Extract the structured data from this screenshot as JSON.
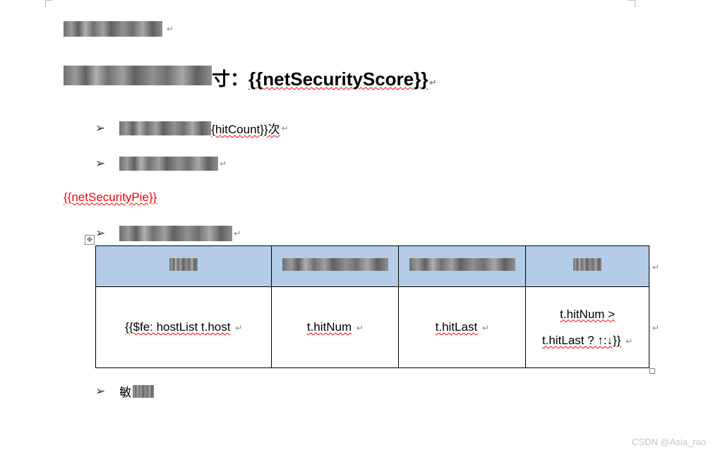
{
  "heading": {
    "suffix_char": "寸：",
    "placeholder": "{{netSecurityScore}}"
  },
  "bullets": {
    "b1_suffix": "{hitCount}}次",
    "b3_prefix": "敏"
  },
  "red_placeholder": "{{netSecurityPie}}",
  "table": {
    "rows": [
      {
        "c1": "{{$fe: hostList t.host",
        "c2": "t.hitNum",
        "c3": "t.hitLast",
        "c4_line1": "t.hitNum >",
        "c4_line2": "t.hitLast ? ↑:↓}}"
      }
    ]
  },
  "watermark": "CSDN @Asia_rao",
  "paragraph_mark": "↵"
}
